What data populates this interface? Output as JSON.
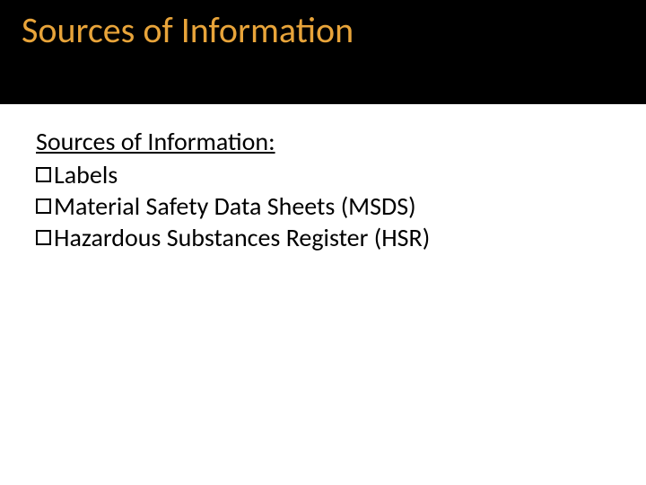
{
  "title": "Sources of Information",
  "subheading": "Sources of Information:",
  "items": [
    {
      "label": "Labels"
    },
    {
      "label": "Material Safety Data Sheets (MSDS)"
    },
    {
      "label": "Hazardous Substances Register (HSR)"
    }
  ]
}
